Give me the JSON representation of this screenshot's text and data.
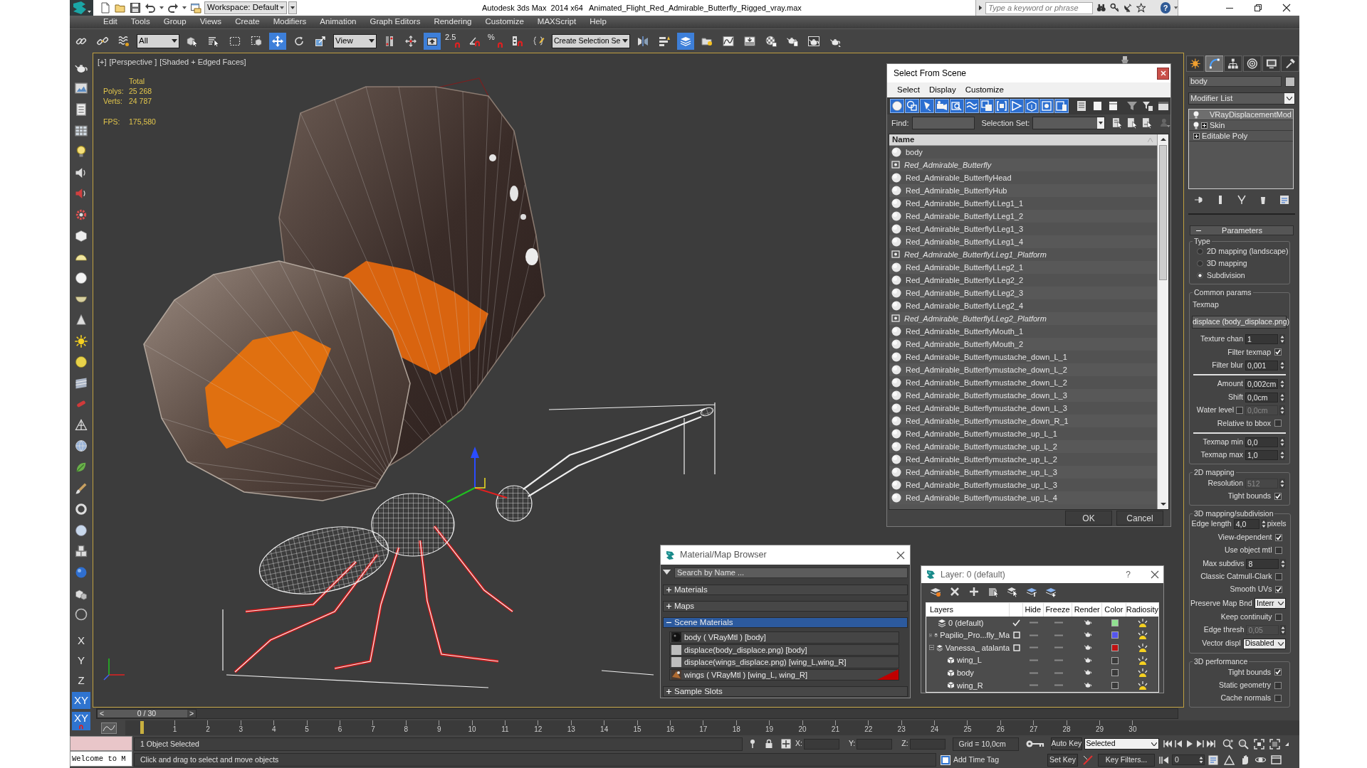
{
  "title_bar": {
    "workspace": "Workspace: Default",
    "app_title": "Autodesk 3ds Max  2014 x64",
    "file_title": "Animated_Flight_Red_Admirable_Butterfly_Rigged_vray.max",
    "search": {
      "placeholder": "Type a keyword or phrase"
    },
    "help_label": "?"
  },
  "menu": [
    "Edit",
    "Tools",
    "Group",
    "Views",
    "Create",
    "Modifiers",
    "Animation",
    "Graph Editors",
    "Rendering",
    "Customize",
    "MAXScript",
    "Help"
  ],
  "main_toolbar": [
    {
      "kind": "link",
      "selected": false
    },
    {
      "kind": "unlink",
      "selected": false
    },
    {
      "kind": "bind",
      "selected": false
    },
    {
      "kind": "dropdown",
      "value": "All"
    },
    {
      "kind": "select",
      "selected": false
    },
    {
      "kind": "select_by_name",
      "selected": false
    },
    {
      "kind": "rect_region",
      "selected": false
    },
    {
      "kind": "window_crossing",
      "selected": false
    },
    {
      "kind": "move",
      "selected": true
    },
    {
      "kind": "rotate",
      "selected": false
    },
    {
      "kind": "scale",
      "selected": false
    },
    {
      "kind": "dropdown",
      "value": "View"
    },
    {
      "kind": "pivot",
      "selected": false
    },
    {
      "kind": "manipulate",
      "selected": false
    },
    {
      "kind": "keyboard_override",
      "selected": true
    },
    {
      "kind": "snap",
      "label": "2.5",
      "selected": false
    },
    {
      "kind": "angle_snap",
      "selected": false
    },
    {
      "kind": "percent_snap",
      "label": "%",
      "selected": false
    },
    {
      "kind": "spinner_snap",
      "selected": false
    },
    {
      "kind": "named_sets",
      "selected": false
    },
    {
      "kind": "dropdown",
      "value": "Create Selection Se"
    },
    {
      "kind": "mirror",
      "selected": false
    },
    {
      "kind": "align",
      "selected": false
    },
    {
      "kind": "layers",
      "selected": true
    },
    {
      "kind": "ribbon",
      "selected": false
    },
    {
      "kind": "curve_editor",
      "selected": false
    },
    {
      "kind": "schematic",
      "selected": false
    },
    {
      "kind": "material_editor",
      "selected": false
    },
    {
      "kind": "render_setup",
      "selected": false
    },
    {
      "kind": "frame_window",
      "selected": false
    },
    {
      "kind": "render",
      "selected": false
    }
  ],
  "axis_buttons": [
    {
      "label": "X",
      "kind": "axis",
      "selected": false
    },
    {
      "label": "Y",
      "kind": "axis",
      "selected": false
    },
    {
      "label": "Z",
      "kind": "axis",
      "selected": false
    },
    {
      "label": "XY",
      "kind": "axis",
      "selected": true
    },
    {
      "label": "XY",
      "kind": "axis_snap",
      "selected": true
    }
  ],
  "viewport": {
    "labels": [
      "[+]",
      "[Perspective ]",
      "[Shaded + Edged Faces]"
    ],
    "stats": {
      "heading": "Total",
      "rows": [
        {
          "label": "Polys:",
          "value": "25 268"
        },
        {
          "label": "Verts:",
          "value": "24 787"
        }
      ]
    },
    "fps": {
      "label": "FPS:",
      "value": "175,580"
    }
  },
  "select_from_scene": {
    "title": "Select From Scene",
    "menu": [
      "Select",
      "Display",
      "Customize"
    ],
    "filters": [
      {
        "kind": "geometry",
        "on": true
      },
      {
        "kind": "shapes",
        "on": true
      },
      {
        "kind": "lights",
        "on": true
      },
      {
        "kind": "cameras",
        "on": true
      },
      {
        "kind": "helpers",
        "on": true
      },
      {
        "kind": "spacewarps",
        "on": true
      },
      {
        "kind": "groups",
        "on": true
      },
      {
        "kind": "xrefs",
        "on": true
      },
      {
        "kind": "bones",
        "on": true
      },
      {
        "kind": "containers",
        "on": true
      },
      {
        "kind": "frozen",
        "on": true
      },
      {
        "kind": "hidden",
        "on": true
      }
    ],
    "find_label": "Find:",
    "selection_set_label": "Selection Set:",
    "column": "Name",
    "objects": [
      {
        "name": "body",
        "kind": "object"
      },
      {
        "name": "Red_Admirable_Butterfly",
        "kind": "helper"
      },
      {
        "name": "Red_Admirable_ButterflyHead",
        "kind": "object"
      },
      {
        "name": "Red_Admirable_ButterflyHub",
        "kind": "object"
      },
      {
        "name": "Red_Admirable_ButterflyLLeg1_1",
        "kind": "object"
      },
      {
        "name": "Red_Admirable_ButterflyLLeg1_2",
        "kind": "object"
      },
      {
        "name": "Red_Admirable_ButterflyLLeg1_3",
        "kind": "object"
      },
      {
        "name": "Red_Admirable_ButterflyLLeg1_4",
        "kind": "object"
      },
      {
        "name": "Red_Admirable_ButterflyLLeg1_Platform",
        "kind": "helper"
      },
      {
        "name": "Red_Admirable_ButterflyLLeg2_1",
        "kind": "object"
      },
      {
        "name": "Red_Admirable_ButterflyLLeg2_2",
        "kind": "object"
      },
      {
        "name": "Red_Admirable_ButterflyLLeg2_3",
        "kind": "object"
      },
      {
        "name": "Red_Admirable_ButterflyLLeg2_4",
        "kind": "object"
      },
      {
        "name": "Red_Admirable_ButterflyLLeg2_Platform",
        "kind": "helper"
      },
      {
        "name": "Red_Admirable_ButterflyMouth_1",
        "kind": "object"
      },
      {
        "name": "Red_Admirable_ButterflyMouth_2",
        "kind": "object"
      },
      {
        "name": "Red_Admirable_Butterflymustache_down_L_1",
        "kind": "object"
      },
      {
        "name": "Red_Admirable_Butterflymustache_down_L_2",
        "kind": "object"
      },
      {
        "name": "Red_Admirable_Butterflymustache_down_L_2",
        "kind": "object"
      },
      {
        "name": "Red_Admirable_Butterflymustache_down_L_3",
        "kind": "object"
      },
      {
        "name": "Red_Admirable_Butterflymustache_down_L_3",
        "kind": "object"
      },
      {
        "name": "Red_Admirable_Butterflymustache_down_R_1",
        "kind": "object"
      },
      {
        "name": "Red_Admirable_Butterflymustache_up_L_1",
        "kind": "object"
      },
      {
        "name": "Red_Admirable_Butterflymustache_up_L_2",
        "kind": "object"
      },
      {
        "name": "Red_Admirable_Butterflymustache_up_L_2",
        "kind": "object"
      },
      {
        "name": "Red_Admirable_Butterflymustache_up_L_3",
        "kind": "object"
      },
      {
        "name": "Red_Admirable_Butterflymustache_up_L_3",
        "kind": "object"
      },
      {
        "name": "Red_Admirable_Butterflymustache_up_L_4",
        "kind": "object"
      }
    ],
    "buttons": [
      "OK",
      "Cancel"
    ]
  },
  "material_browser": {
    "title": "Material/Map Browser",
    "search": {
      "placeholder": "Search by Name ..."
    },
    "groups": [
      {
        "label": "Materials",
        "expanded": false,
        "selected": false
      },
      {
        "label": "Maps",
        "expanded": false,
        "selected": false
      },
      {
        "label": "Scene Materials",
        "expanded": true,
        "selected": true,
        "items": [
          {
            "label": "body ( VRayMtl ) [body]",
            "kind": "material",
            "hot": false
          },
          {
            "label": "displace(body_displace.png) [body]",
            "kind": "map",
            "hot": false
          },
          {
            "label": "displace(wings_displace.png) [wing_L,wing_R]",
            "kind": "map",
            "hot": false
          },
          {
            "label": "wings ( VRayMtl ) [wing_L, wing_R]",
            "kind": "textured_material",
            "hot": true
          }
        ]
      },
      {
        "label": "Sample Slots",
        "expanded": false,
        "selected": false
      }
    ]
  },
  "layer_manager": {
    "title": "Layer: 0 (default)",
    "help_label": "?",
    "columns": [
      "Layers",
      "Hide",
      "Freeze",
      "Render",
      "Color",
      "Radiosity"
    ],
    "layers": [
      {
        "name": "0 (default)",
        "current": true,
        "color": "#8fe08f"
      },
      {
        "name": "Papilio_Pro...fly_Ma",
        "current": false,
        "expanded": false,
        "color": "#5555ee"
      },
      {
        "name": "Vanessa_ atalanta",
        "current": false,
        "expanded": true,
        "color": "#c01212",
        "children": [
          {
            "name": "wing_L"
          },
          {
            "name": "body"
          },
          {
            "name": "wing_R"
          }
        ]
      }
    ]
  },
  "command_panel": {
    "tabs": [
      {
        "kind": "create",
        "selected": false
      },
      {
        "kind": "modify",
        "selected": true
      },
      {
        "kind": "hierarchy",
        "selected": false
      },
      {
        "kind": "motion",
        "selected": false
      },
      {
        "kind": "display",
        "selected": false
      },
      {
        "kind": "utilities",
        "selected": false
      }
    ],
    "object_name": "body",
    "modifier_list": "Modifier List",
    "stack": [
      {
        "name": "VRayDisplacementMod",
        "kind": "modifier",
        "selected": true
      },
      {
        "name": "Skin",
        "kind": "modifier",
        "selected": false,
        "expanded": false
      },
      {
        "name": "Editable Poly",
        "kind": "base",
        "selected": false,
        "expanded": false
      }
    ],
    "rollout": {
      "title": "Parameters",
      "expanded": true,
      "groups": [
        {
          "title": "Type",
          "controls": [
            {
              "kind": "radio",
              "label": "2D mapping (landscape)",
              "selected": false
            },
            {
              "kind": "radio",
              "label": "3D mapping",
              "selected": false
            },
            {
              "kind": "radio",
              "label": "Subdivision",
              "selected": true
            }
          ]
        },
        {
          "title": "Common params",
          "controls": [
            {
              "kind": "label",
              "label": "Texmap"
            },
            {
              "kind": "map_button",
              "label": "displace (body_displace.png)"
            },
            {
              "kind": "spinner",
              "label": "Texture chan",
              "value": "1",
              "disabled": false
            },
            {
              "kind": "checkbox",
              "label": "Filter texmap",
              "checked": true
            },
            {
              "kind": "spinner",
              "label": "Filter blur",
              "value": "0,001",
              "disabled": false
            },
            {
              "kind": "separator"
            },
            {
              "kind": "spinner",
              "label": "Amount",
              "value": "0,002cm",
              "disabled": false
            },
            {
              "kind": "spinner",
              "label": "Shift",
              "value": "0,0cm",
              "disabled": false
            },
            {
              "kind": "check_spinner",
              "label": "Water level",
              "checked": false,
              "value": "0,0cm",
              "disabled": true
            },
            {
              "kind": "checkbox",
              "label": "Relative to bbox",
              "checked": false
            },
            {
              "kind": "separator"
            },
            {
              "kind": "spinner",
              "label": "Texmap min",
              "value": "0,0",
              "disabled": false
            },
            {
              "kind": "spinner",
              "label": "Texmap max",
              "value": "1,0",
              "disabled": false
            }
          ]
        },
        {
          "title": "2D mapping",
          "controls": [
            {
              "kind": "spinner",
              "label": "Resolution",
              "value": "512",
              "disabled": true
            },
            {
              "kind": "checkbox",
              "label": "Tight bounds",
              "checked": true
            }
          ]
        },
        {
          "title": "3D mapping/subdivision",
          "controls": [
            {
              "kind": "spinner",
              "label": "Edge length",
              "value": "4,0",
              "unit": "pixels",
              "disabled": false
            },
            {
              "kind": "checkbox",
              "label": "View-dependent",
              "checked": true
            },
            {
              "kind": "checkbox",
              "label": "Use object mtl",
              "checked": false
            },
            {
              "kind": "spinner",
              "label": "Max subdivs",
              "value": "8",
              "disabled": false
            },
            {
              "kind": "checkbox",
              "label": "Classic Catmull-Clark",
              "checked": false
            },
            {
              "kind": "checkbox",
              "label": "Smooth UVs",
              "checked": true
            },
            {
              "kind": "dropdown",
              "label": "Preserve Map Bnd",
              "value": "Interr"
            },
            {
              "kind": "checkbox",
              "label": "Keep continuity",
              "checked": false
            },
            {
              "kind": "spinner",
              "label": "Edge thresh",
              "value": "0,05",
              "disabled": true
            },
            {
              "kind": "dropdown",
              "label": "Vector displ",
              "value": "Disabled"
            }
          ]
        },
        {
          "title": "3D performance",
          "controls": [
            {
              "kind": "checkbox",
              "label": "Tight bounds",
              "checked": true
            },
            {
              "kind": "checkbox",
              "label": "Static geometry",
              "checked": false
            },
            {
              "kind": "checkbox",
              "label": "Cache normals",
              "checked": false
            }
          ]
        }
      ]
    }
  },
  "time_slider": {
    "prev": "<",
    "label": "0 / 30",
    "next": ">",
    "level": 0
  },
  "timeline": {
    "ticks": [
      "1",
      "2",
      "3",
      "4",
      "5",
      "6",
      "7",
      "8",
      "9",
      "10",
      "11",
      "12",
      "13",
      "14",
      "15",
      "16",
      "17",
      "18",
      "19",
      "20",
      "21",
      "22",
      "23",
      "24",
      "25",
      "26",
      "27",
      "28",
      "29",
      "30"
    ]
  },
  "status_bar": {
    "listener_output": "Welcome to M",
    "selection": "1 Object Selected",
    "prompt": "Click and drag to select and move objects",
    "coordinates": [
      {
        "label": "X:"
      },
      {
        "label": "Y:"
      },
      {
        "label": "Z:"
      }
    ],
    "grid": "Grid = 10,0cm",
    "add_time_tag": "Add Time Tag",
    "auto_key": "Auto Key",
    "set_key": "Set Key",
    "key_mode": "Selected",
    "key_filters": "Key Filters...",
    "frame": "0"
  }
}
